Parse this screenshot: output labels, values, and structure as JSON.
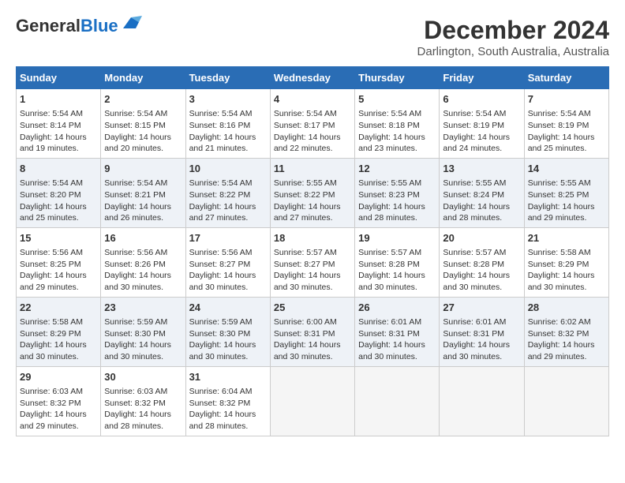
{
  "header": {
    "logo_general": "General",
    "logo_blue": "Blue",
    "month": "December 2024",
    "location": "Darlington, South Australia, Australia"
  },
  "weekdays": [
    "Sunday",
    "Monday",
    "Tuesday",
    "Wednesday",
    "Thursday",
    "Friday",
    "Saturday"
  ],
  "weeks": [
    [
      {
        "day": "1",
        "lines": [
          "Sunrise: 5:54 AM",
          "Sunset: 8:14 PM",
          "Daylight: 14 hours",
          "and 19 minutes."
        ]
      },
      {
        "day": "2",
        "lines": [
          "Sunrise: 5:54 AM",
          "Sunset: 8:15 PM",
          "Daylight: 14 hours",
          "and 20 minutes."
        ]
      },
      {
        "day": "3",
        "lines": [
          "Sunrise: 5:54 AM",
          "Sunset: 8:16 PM",
          "Daylight: 14 hours",
          "and 21 minutes."
        ]
      },
      {
        "day": "4",
        "lines": [
          "Sunrise: 5:54 AM",
          "Sunset: 8:17 PM",
          "Daylight: 14 hours",
          "and 22 minutes."
        ]
      },
      {
        "day": "5",
        "lines": [
          "Sunrise: 5:54 AM",
          "Sunset: 8:18 PM",
          "Daylight: 14 hours",
          "and 23 minutes."
        ]
      },
      {
        "day": "6",
        "lines": [
          "Sunrise: 5:54 AM",
          "Sunset: 8:19 PM",
          "Daylight: 14 hours",
          "and 24 minutes."
        ]
      },
      {
        "day": "7",
        "lines": [
          "Sunrise: 5:54 AM",
          "Sunset: 8:19 PM",
          "Daylight: 14 hours",
          "and 25 minutes."
        ]
      }
    ],
    [
      {
        "day": "8",
        "lines": [
          "Sunrise: 5:54 AM",
          "Sunset: 8:20 PM",
          "Daylight: 14 hours",
          "and 25 minutes."
        ]
      },
      {
        "day": "9",
        "lines": [
          "Sunrise: 5:54 AM",
          "Sunset: 8:21 PM",
          "Daylight: 14 hours",
          "and 26 minutes."
        ]
      },
      {
        "day": "10",
        "lines": [
          "Sunrise: 5:54 AM",
          "Sunset: 8:22 PM",
          "Daylight: 14 hours",
          "and 27 minutes."
        ]
      },
      {
        "day": "11",
        "lines": [
          "Sunrise: 5:55 AM",
          "Sunset: 8:22 PM",
          "Daylight: 14 hours",
          "and 27 minutes."
        ]
      },
      {
        "day": "12",
        "lines": [
          "Sunrise: 5:55 AM",
          "Sunset: 8:23 PM",
          "Daylight: 14 hours",
          "and 28 minutes."
        ]
      },
      {
        "day": "13",
        "lines": [
          "Sunrise: 5:55 AM",
          "Sunset: 8:24 PM",
          "Daylight: 14 hours",
          "and 28 minutes."
        ]
      },
      {
        "day": "14",
        "lines": [
          "Sunrise: 5:55 AM",
          "Sunset: 8:25 PM",
          "Daylight: 14 hours",
          "and 29 minutes."
        ]
      }
    ],
    [
      {
        "day": "15",
        "lines": [
          "Sunrise: 5:56 AM",
          "Sunset: 8:25 PM",
          "Daylight: 14 hours",
          "and 29 minutes."
        ]
      },
      {
        "day": "16",
        "lines": [
          "Sunrise: 5:56 AM",
          "Sunset: 8:26 PM",
          "Daylight: 14 hours",
          "and 30 minutes."
        ]
      },
      {
        "day": "17",
        "lines": [
          "Sunrise: 5:56 AM",
          "Sunset: 8:27 PM",
          "Daylight: 14 hours",
          "and 30 minutes."
        ]
      },
      {
        "day": "18",
        "lines": [
          "Sunrise: 5:57 AM",
          "Sunset: 8:27 PM",
          "Daylight: 14 hours",
          "and 30 minutes."
        ]
      },
      {
        "day": "19",
        "lines": [
          "Sunrise: 5:57 AM",
          "Sunset: 8:28 PM",
          "Daylight: 14 hours",
          "and 30 minutes."
        ]
      },
      {
        "day": "20",
        "lines": [
          "Sunrise: 5:57 AM",
          "Sunset: 8:28 PM",
          "Daylight: 14 hours",
          "and 30 minutes."
        ]
      },
      {
        "day": "21",
        "lines": [
          "Sunrise: 5:58 AM",
          "Sunset: 8:29 PM",
          "Daylight: 14 hours",
          "and 30 minutes."
        ]
      }
    ],
    [
      {
        "day": "22",
        "lines": [
          "Sunrise: 5:58 AM",
          "Sunset: 8:29 PM",
          "Daylight: 14 hours",
          "and 30 minutes."
        ]
      },
      {
        "day": "23",
        "lines": [
          "Sunrise: 5:59 AM",
          "Sunset: 8:30 PM",
          "Daylight: 14 hours",
          "and 30 minutes."
        ]
      },
      {
        "day": "24",
        "lines": [
          "Sunrise: 5:59 AM",
          "Sunset: 8:30 PM",
          "Daylight: 14 hours",
          "and 30 minutes."
        ]
      },
      {
        "day": "25",
        "lines": [
          "Sunrise: 6:00 AM",
          "Sunset: 8:31 PM",
          "Daylight: 14 hours",
          "and 30 minutes."
        ]
      },
      {
        "day": "26",
        "lines": [
          "Sunrise: 6:01 AM",
          "Sunset: 8:31 PM",
          "Daylight: 14 hours",
          "and 30 minutes."
        ]
      },
      {
        "day": "27",
        "lines": [
          "Sunrise: 6:01 AM",
          "Sunset: 8:31 PM",
          "Daylight: 14 hours",
          "and 30 minutes."
        ]
      },
      {
        "day": "28",
        "lines": [
          "Sunrise: 6:02 AM",
          "Sunset: 8:32 PM",
          "Daylight: 14 hours",
          "and 29 minutes."
        ]
      }
    ],
    [
      {
        "day": "29",
        "lines": [
          "Sunrise: 6:03 AM",
          "Sunset: 8:32 PM",
          "Daylight: 14 hours",
          "and 29 minutes."
        ]
      },
      {
        "day": "30",
        "lines": [
          "Sunrise: 6:03 AM",
          "Sunset: 8:32 PM",
          "Daylight: 14 hours",
          "and 28 minutes."
        ]
      },
      {
        "day": "31",
        "lines": [
          "Sunrise: 6:04 AM",
          "Sunset: 8:32 PM",
          "Daylight: 14 hours",
          "and 28 minutes."
        ]
      },
      null,
      null,
      null,
      null
    ]
  ]
}
